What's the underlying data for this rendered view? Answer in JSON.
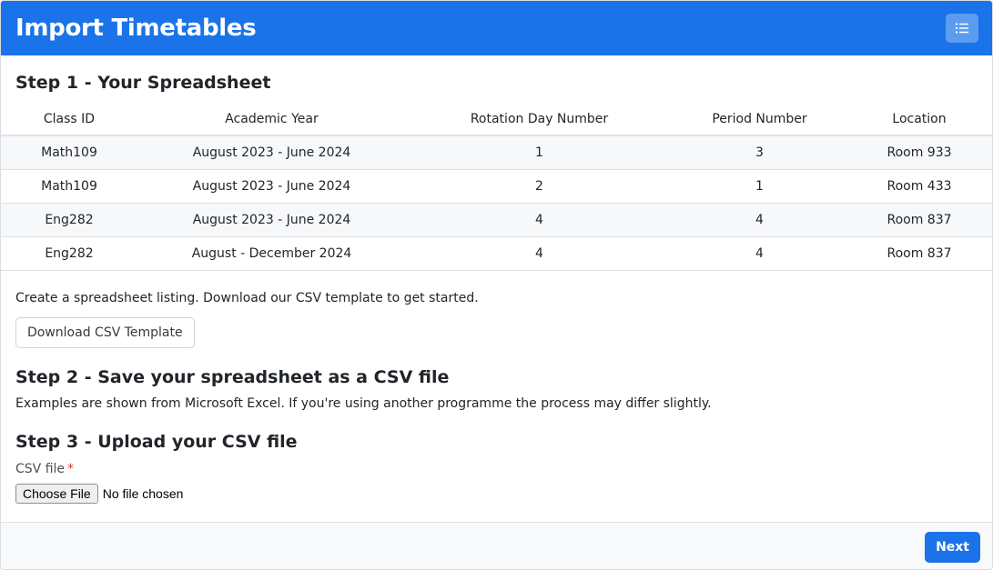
{
  "header": {
    "title": "Import Timetables",
    "menu_icon": "list-icon"
  },
  "step1": {
    "title": "Step 1 - Your Spreadsheet",
    "columns": [
      "Class ID",
      "Academic Year",
      "Rotation Day Number",
      "Period Number",
      "Location"
    ],
    "rows": [
      [
        "Math109",
        "August 2023 - June 2024",
        "1",
        "3",
        "Room 933"
      ],
      [
        "Math109",
        "August 2023 - June 2024",
        "2",
        "1",
        "Room 433"
      ],
      [
        "Eng282",
        "August 2023 - June 2024",
        "4",
        "4",
        "Room 837"
      ],
      [
        "Eng282",
        "August - December 2024",
        "4",
        "4",
        "Room 837"
      ]
    ],
    "description": "Create a spreadsheet listing. Download our CSV template to get started.",
    "download_label": "Download CSV Template"
  },
  "step2": {
    "title": "Step 2 - Save your spreadsheet as a CSV file",
    "description": "Examples are shown from Microsoft Excel. If you're using another programme the process may differ slightly."
  },
  "step3": {
    "title": "Step 3 - Upload your CSV file",
    "field_label": "CSV file",
    "required_mark": "*",
    "choose_label": "Choose File",
    "file_status": "No file chosen"
  },
  "footer": {
    "next_label": "Next"
  },
  "colors": {
    "primary": "#1a73e8",
    "required": "#dc3545"
  }
}
